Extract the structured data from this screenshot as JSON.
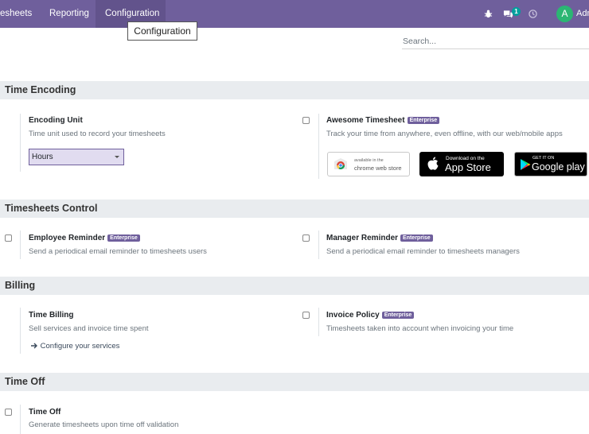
{
  "topbar": {
    "menus": [
      "esheets",
      "Reporting",
      "Configuration"
    ],
    "chat_badge": "1",
    "avatar_letter": "A",
    "user_name": "Adm",
    "icons": [
      "bug-icon",
      "chat-icon",
      "clock-icon"
    ],
    "bg_color": "#6f5f9c"
  },
  "tooltip": {
    "text": "Configuration"
  },
  "search": {
    "placeholder": "Search..."
  },
  "enterprise_label": "Enterprise",
  "sections": {
    "time_encoding": {
      "header": "Time Encoding",
      "encoding_unit": {
        "title": "Encoding Unit",
        "desc": "Time unit used to record your timesheets",
        "selected": "Hours"
      },
      "awesome": {
        "title": "Awesome Timesheet",
        "desc": "Track your time from anywhere, even offline, with our web/mobile apps",
        "chrome_small": "available in the",
        "chrome_big": "chrome web store",
        "apple_small": "Download on the",
        "apple_big": "App Store",
        "google_small": "GET IT ON",
        "google_big": "Google play"
      }
    },
    "timesheets_control": {
      "header": "Timesheets Control",
      "employee": {
        "title": "Employee Reminder",
        "desc": "Send a periodical email reminder to timesheets users"
      },
      "manager": {
        "title": "Manager Reminder",
        "desc": "Send a periodical email reminder to timesheets managers"
      }
    },
    "billing": {
      "header": "Billing",
      "time_billing": {
        "title": "Time Billing",
        "desc": "Sell services and invoice time spent",
        "link": "Configure your services"
      },
      "invoice_policy": {
        "title": "Invoice Policy",
        "desc": "Timesheets taken into account when invoicing your time"
      }
    },
    "time_off": {
      "header": "Time Off",
      "time_off": {
        "title": "Time Off",
        "desc": "Generate timesheets upon time off validation"
      }
    }
  }
}
